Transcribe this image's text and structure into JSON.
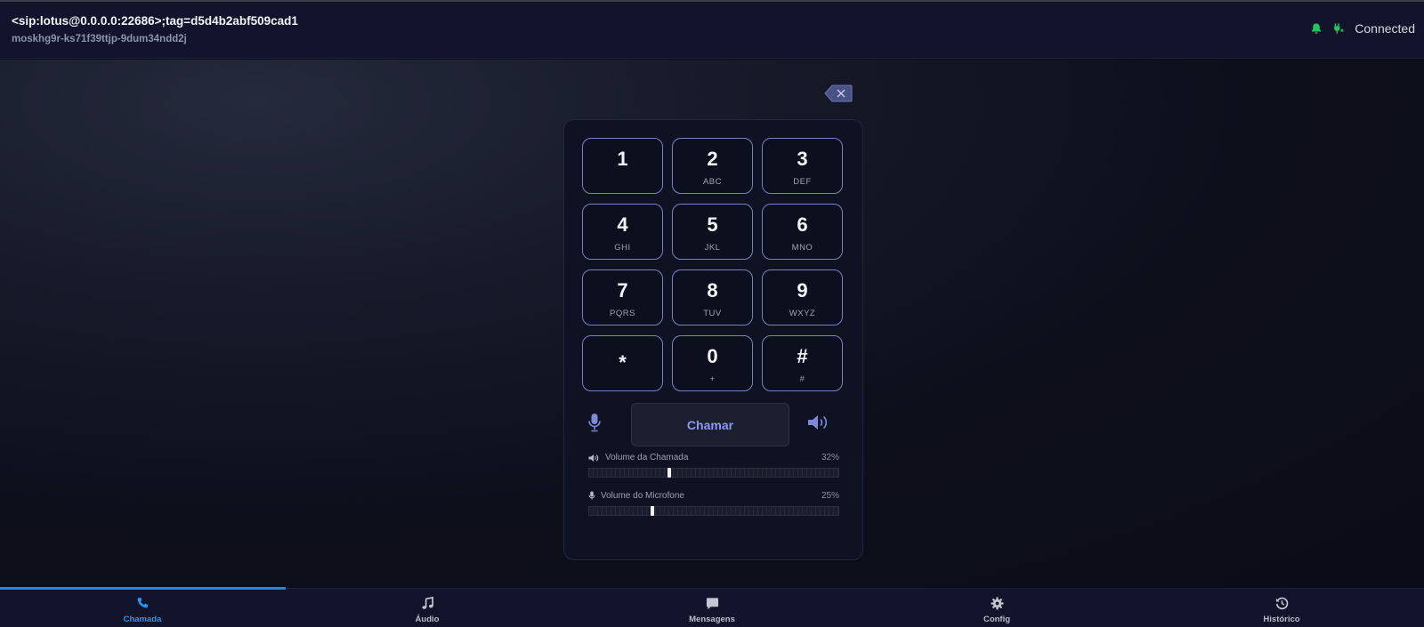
{
  "header": {
    "sip_uri": "<sip:lotus@0.0.0.0:22686>;tag=d5d4b2abf509cad1",
    "instance_id": "moskhg9r-ks71f39ttjp-9dum34ndd2j",
    "status_text": "Connected",
    "status_color": "#22c55e",
    "icons": [
      "bell-icon",
      "plug-icon"
    ]
  },
  "dialpad": {
    "keys": [
      {
        "digit": "1",
        "letters": ""
      },
      {
        "digit": "2",
        "letters": "ABC"
      },
      {
        "digit": "3",
        "letters": "DEF"
      },
      {
        "digit": "4",
        "letters": "GHI"
      },
      {
        "digit": "5",
        "letters": "JKL"
      },
      {
        "digit": "6",
        "letters": "MNO"
      },
      {
        "digit": "7",
        "letters": "PQRS"
      },
      {
        "digit": "8",
        "letters": "TUV"
      },
      {
        "digit": "9",
        "letters": "WXYZ"
      },
      {
        "digit": "*",
        "letters": ""
      },
      {
        "digit": "0",
        "letters": "+"
      },
      {
        "digit": "#",
        "letters": "#"
      }
    ],
    "call_label": "Chamar",
    "call_volume": {
      "label": "Volume da Chamada",
      "percent_text": "32%",
      "value": 0.32
    },
    "mic_volume": {
      "label": "Volume do Microfone",
      "percent_text": "25%",
      "value": 0.25
    }
  },
  "nav": {
    "items": [
      {
        "label": "Chamada",
        "icon": "phone-icon",
        "active": true
      },
      {
        "label": "Áudio",
        "icon": "music-icon",
        "active": false
      },
      {
        "label": "Mensagens",
        "icon": "message-icon",
        "active": false
      },
      {
        "label": "Config",
        "icon": "gear-icon",
        "active": false
      },
      {
        "label": "Histórico",
        "icon": "history-icon",
        "active": false
      }
    ]
  },
  "colors": {
    "accent": "#1e88e5",
    "key_border": "#7a80c0",
    "palette_button": "#7b4fd0"
  }
}
